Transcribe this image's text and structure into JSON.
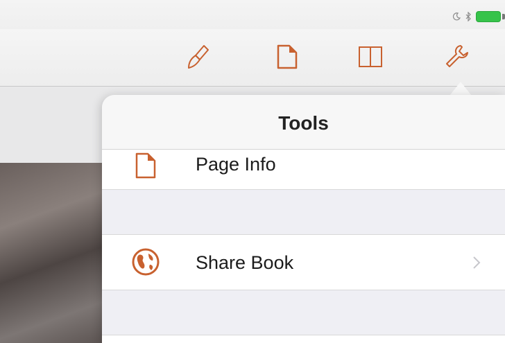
{
  "status_bar": {
    "icons": [
      "moon-icon",
      "bluetooth-icon",
      "battery-icon"
    ],
    "battery_color": "#36c34a"
  },
  "toolbar": {
    "icons": [
      "paintbrush-icon",
      "page-icon",
      "book-icon",
      "wrench-icon"
    ],
    "accent_color": "#c8612f"
  },
  "popover": {
    "title": "Tools",
    "items": [
      {
        "label": "Page Info",
        "icon": "page-icon"
      },
      {
        "label": "Share Book",
        "icon": "globe-icon",
        "chevron": true
      }
    ]
  }
}
